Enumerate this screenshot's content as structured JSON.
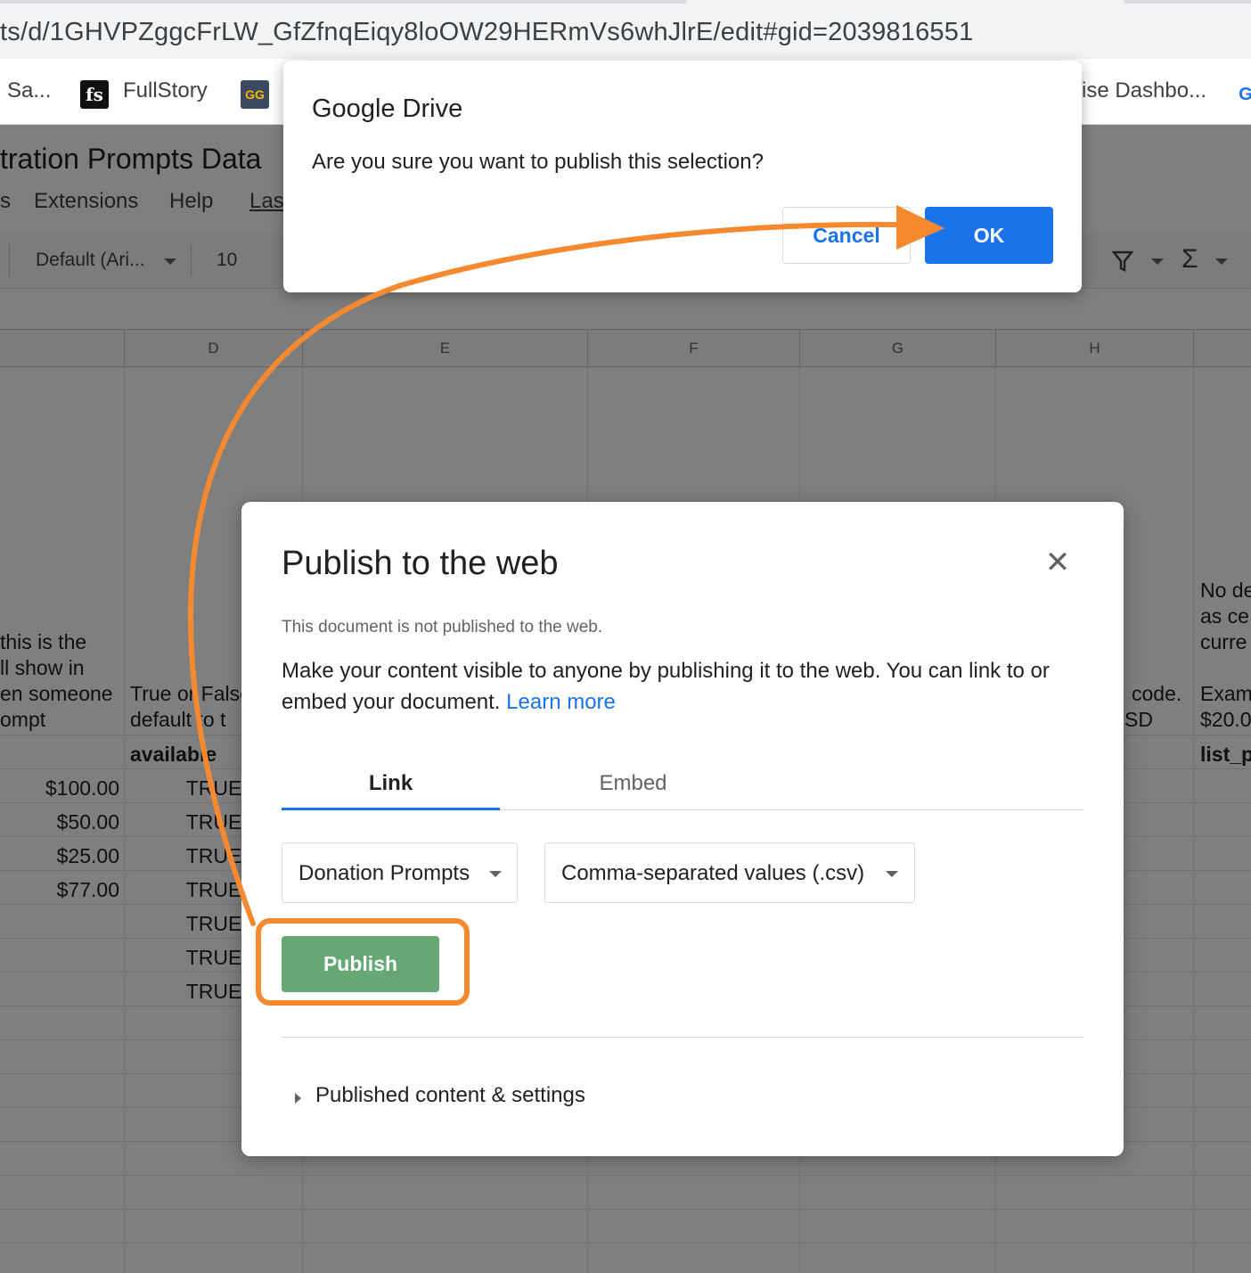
{
  "browser": {
    "url": "ts/d/1GHVPZggcFrLW_GfZfnqEiqy8loOW29HERmVs6whJlrE/edit#gid=2039816551",
    "bookmarks": [
      {
        "label": "Sa..."
      },
      {
        "icon_text": "fs",
        "label": "FullStory"
      },
      {
        "icon_text": "GG"
      },
      {
        "label": "ise Dashbo..."
      },
      {
        "icon_text": "G"
      }
    ]
  },
  "sheet": {
    "doc_title": "tration Prompts Data",
    "menu": [
      "s",
      "Extensions",
      "Help",
      "Las"
    ],
    "toolbar": {
      "font": "Default (Ari...",
      "size": "10"
    },
    "columns": [
      "D",
      "E",
      "F",
      "G",
      "H"
    ],
    "col_c_header_lines": [
      "this is the",
      "ll show in",
      "en someone",
      "ompt"
    ],
    "col_d_header_lines": [
      "True or False",
      "default to t"
    ],
    "col_d_field": "available",
    "col_h_header_lines": [
      "code.",
      "SD"
    ],
    "col_i_header_lines": [
      "No de",
      "as ce",
      "curre",
      "",
      "Exam",
      "$20.0"
    ],
    "col_i_field": "list_p",
    "amounts": [
      "$100.00",
      "$50.00",
      "$25.00",
      "$77.00"
    ],
    "bools": [
      "TRUE",
      "TRUE",
      "TRUE",
      "TRUE",
      "TRUE",
      "TRUE",
      "TRUE"
    ]
  },
  "confirm_dialog": {
    "title": "Google Drive",
    "message": "Are you sure you want to publish this selection?",
    "cancel_label": "Cancel",
    "ok_label": "OK"
  },
  "publish_dialog": {
    "title": "Publish to the web",
    "status": "This document is not published to the web.",
    "description": "Make your content visible to anyone by publishing it to the web. You can link to or embed your document.",
    "learn_more": "Learn more",
    "tabs": [
      {
        "label": "Link",
        "active": true
      },
      {
        "label": "Embed",
        "active": false
      }
    ],
    "sheet_select": "Donation Prompts",
    "format_select": "Comma-separated values (.csv)",
    "publish_label": "Publish",
    "expander_label": "Published content & settings"
  },
  "colors": {
    "annotation": "#f5892f",
    "primary": "#1a73e8",
    "publish_green": "#66a874"
  }
}
